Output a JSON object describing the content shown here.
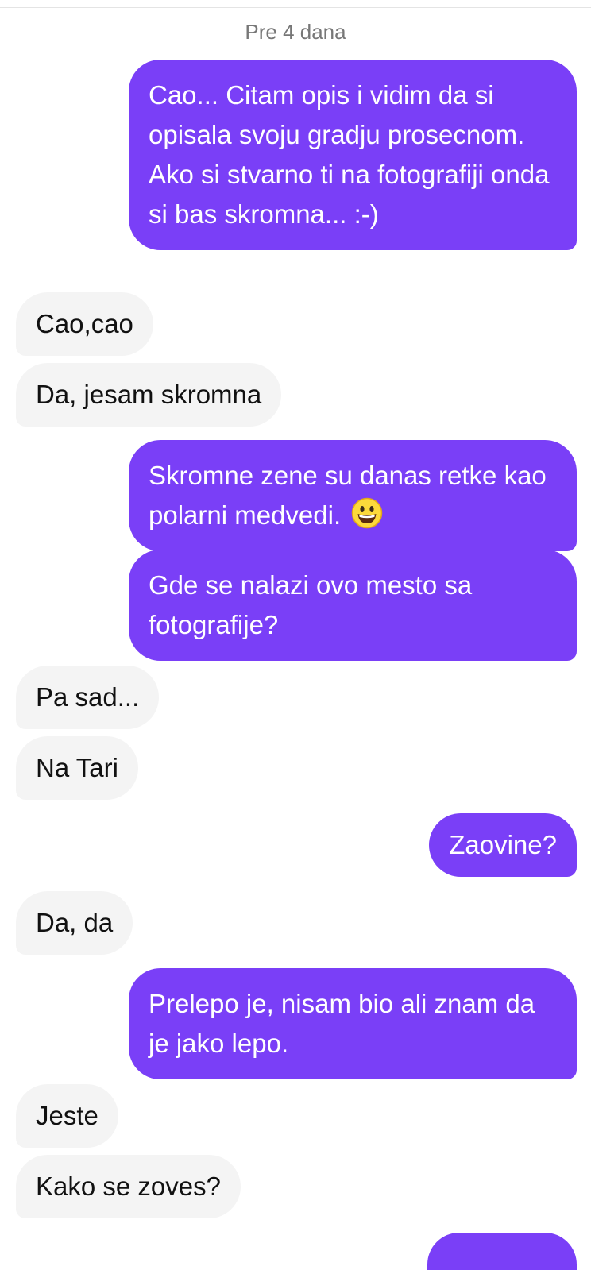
{
  "conversation": {
    "date_separator": "Pre 4 dana",
    "messages": [
      {
        "from": "me",
        "text": "Cao... Citam opis i vidim da si opisala svoju gradju prosecnom. Ako si stvarno ti na fotografiji onda si bas skromna... :-)"
      },
      {
        "from": "them",
        "text": "Cao,cao"
      },
      {
        "from": "them",
        "text": "Da, jesam skromna"
      },
      {
        "from": "me",
        "text": "Skromne zene su danas retke kao polarni medvedi.",
        "emoji": "grinning-face-emoji"
      },
      {
        "from": "me",
        "text": "Gde se nalazi ovo mesto sa fotografije?"
      },
      {
        "from": "them",
        "text": "Pa sad..."
      },
      {
        "from": "them",
        "text": "Na Tari"
      },
      {
        "from": "me",
        "text": "Zaovine?"
      },
      {
        "from": "them",
        "text": "Da, da"
      },
      {
        "from": "me",
        "text": "Prelepo je, nisam bio ali znam da je jako lepo."
      },
      {
        "from": "them",
        "text": "Jeste"
      },
      {
        "from": "them",
        "text": "Kako se zoves?"
      }
    ]
  },
  "colors": {
    "outgoing_bubble": "#7a3ff7",
    "incoming_bubble": "#f4f4f4",
    "outgoing_text": "#ffffff",
    "incoming_text": "#111111",
    "date_text": "#777777"
  }
}
